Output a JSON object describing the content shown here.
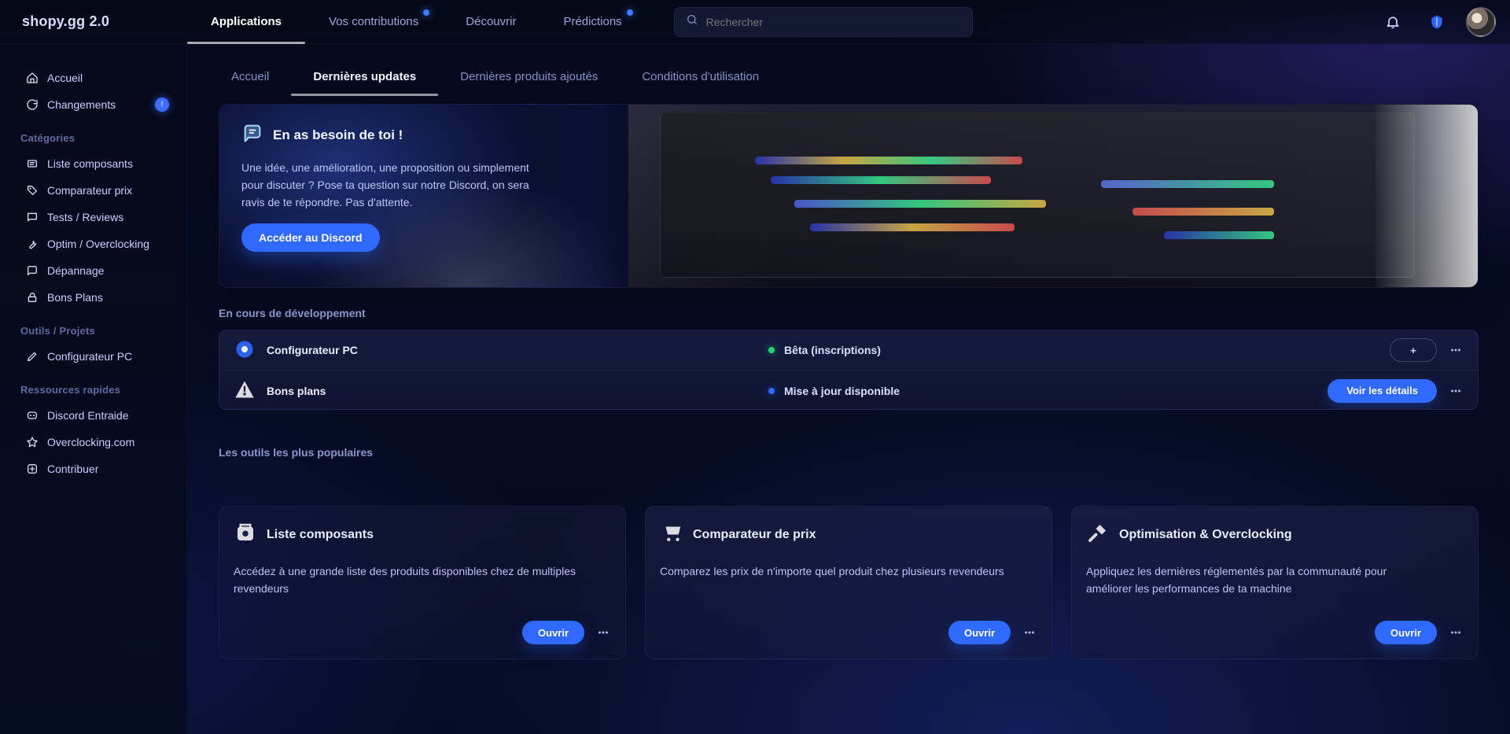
{
  "topbar": {
    "brand": "shopy.gg 2.0",
    "tabs": [
      {
        "label": "Applications",
        "active": true,
        "dot": false
      },
      {
        "label": "Vos contributions",
        "active": false,
        "dot": true
      },
      {
        "label": "Découvrir",
        "active": false,
        "dot": false
      },
      {
        "label": "Prédictions",
        "active": false,
        "dot": true
      }
    ],
    "search": {
      "placeholder": "Rechercher",
      "value": ""
    },
    "icons": {
      "notifications": "bell-icon",
      "shield": "shield-icon"
    }
  },
  "sidebar": {
    "top_items": [
      {
        "label": "Accueil",
        "icon": "home-icon"
      },
      {
        "label": "Changements",
        "icon": "changes-icon",
        "badge": "!"
      }
    ],
    "sections": [
      {
        "title": "Catégories",
        "items": [
          {
            "label": "Liste composants",
            "icon": "list-icon"
          },
          {
            "label": "Comparateur prix",
            "icon": "tag-icon"
          },
          {
            "label": "Tests / Reviews",
            "icon": "chat-icon"
          },
          {
            "label": "Optim / Overclocking",
            "icon": "wrench-icon"
          },
          {
            "label": "Dépannage",
            "icon": "bubble-icon"
          },
          {
            "label": "Bons Plans",
            "icon": "lock-icon"
          }
        ]
      },
      {
        "title": "Outils / Projets",
        "items": [
          {
            "label": "Configurateur PC",
            "icon": "pen-icon"
          }
        ]
      },
      {
        "title": "Ressources rapides",
        "items": [
          {
            "label": "Discord Entraide",
            "icon": "discord-icon"
          },
          {
            "label": "Overclocking.com",
            "icon": "star-icon"
          },
          {
            "label": "Contribuer",
            "icon": "plus-icon"
          }
        ]
      }
    ]
  },
  "content": {
    "subtabs": [
      {
        "label": "Accueil",
        "active": false
      },
      {
        "label": "Dernières updates",
        "active": true
      },
      {
        "label": "Dernières produits ajoutés",
        "active": false
      },
      {
        "label": "Conditions d'utilisation",
        "active": false
      }
    ],
    "hero": {
      "title": "En as besoin de toi !",
      "description": "Une idée, une amélioration, une proposition ou simplement pour discuter ? Pose ta question sur notre Discord, on sera ravis de te répondre. Pas d'attente.",
      "cta_label": "Accéder au Discord"
    },
    "dev": {
      "section_title": "En cours de développement",
      "rows": [
        {
          "name": "Configurateur PC",
          "icon": "gear-icon",
          "status_text": "Bêta (inscriptions)",
          "status_color": "#23d37a",
          "action": {
            "type": "ghost",
            "label": "+"
          }
        },
        {
          "name": "Bons plans",
          "icon": "warning-icon",
          "status_text": "Mise à jour disponible",
          "status_color": "#2f69ff",
          "action": {
            "type": "primary",
            "label": "Voir les détails"
          }
        }
      ]
    },
    "popular": {
      "section_title": "Les outils les plus populaires",
      "cards": [
        {
          "title": "Liste composants",
          "icon": "box-icon",
          "description": "Accédez à une grande liste des produits disponibles chez de multiples revendeurs",
          "button_label": "Ouvrir"
        },
        {
          "title": "Comparateur de prix",
          "icon": "cart-icon",
          "description": "Comparez les prix de n'importe quel produit chez plusieurs revendeurs",
          "button_label": "Ouvrir"
        },
        {
          "title": "Optimisation & Overclocking",
          "icon": "tools-icon",
          "description": "Appliquez les dernières réglementés par la communauté pour améliorer les performances de ta machine",
          "button_label": "Ouvrir"
        }
      ]
    }
  }
}
